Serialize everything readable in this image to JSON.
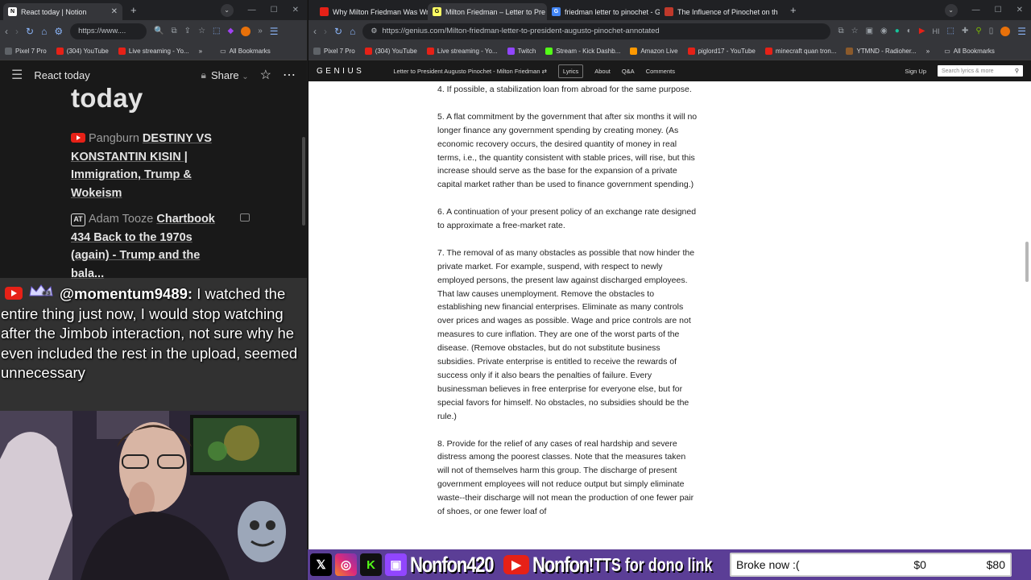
{
  "left_browser": {
    "tabs": [
      {
        "title": "React today | Notion",
        "active": true
      }
    ],
    "url": "https://www....",
    "bookmarks": [
      {
        "label": "Pixel 7 Pro",
        "color": "#5f6368"
      },
      {
        "label": "(304) YouTube",
        "color": "#e62117"
      },
      {
        "label": "Live streaming - Yo...",
        "color": "#e62117"
      }
    ],
    "bookmarks_more": "All Bookmarks"
  },
  "notion": {
    "page_header": "React today",
    "share_label": "Share",
    "title": "today",
    "items": [
      {
        "source": "Pangburn",
        "title": "DESTINY VS KONSTANTIN KISIN | Immigration, Trump & Wokeism",
        "badge": "youtube"
      },
      {
        "source": "Adam Tooze",
        "title": "Chartbook 434 Back to the 1970s (again) - Trump and the bala...",
        "badge": "AT"
      }
    ]
  },
  "chat": {
    "username": "@momentum9489:",
    "badge_text": "#3",
    "message": "I watched the entire thing just now, I would stop watching after the Jimbob interaction, not sure why he even included the rest in the upload, seemed unnecessary"
  },
  "right_browser": {
    "tabs": [
      {
        "title": "Why Milton Friedman Was Wro",
        "fav_color": "#e62117",
        "active": false
      },
      {
        "title": "Milton Friedman – Letter to Pre",
        "fav_color": "#ffff64",
        "active": true
      },
      {
        "title": "friedman letter to pinochet - G",
        "fav_color": "#4285f4",
        "active": false
      },
      {
        "title": "The Influence of Pinochet on th",
        "fav_color": "#c0392b",
        "active": false
      }
    ],
    "url": "https://genius.com/Milton-friedman-letter-to-president-augusto-pinochet-annotated",
    "bookmarks": [
      {
        "label": "Pixel 7 Pro",
        "color": "#5f6368"
      },
      {
        "label": "(304) YouTube",
        "color": "#e62117"
      },
      {
        "label": "Live streaming - Yo...",
        "color": "#e62117"
      },
      {
        "label": "Twitch",
        "color": "#9146ff"
      },
      {
        "label": "Stream - Kick Dashb...",
        "color": "#53fc18"
      },
      {
        "label": "Amazon Live",
        "color": "#ff9900"
      },
      {
        "label": "piglord17 - YouTube",
        "color": "#e62117"
      },
      {
        "label": "minecraft quan tron...",
        "color": "#e62117"
      },
      {
        "label": "YTMND - Radioher...",
        "color": "#8b5a2b"
      }
    ],
    "bookmarks_more": "All Bookmarks"
  },
  "genius": {
    "logo": "GENIUS",
    "song_title": "Letter to President Augusto Pinochet - Milton Friedman",
    "nav": [
      "Lyrics",
      "About",
      "Q&A",
      "Comments"
    ],
    "active_nav": "Lyrics",
    "signup": "Sign Up",
    "search_placeholder": "Search lyrics & more",
    "paragraphs": [
      "4. If possible, a stabilization loan from abroad for the same purpose.",
      "5. A flat commitment by the government that after six months it will no longer finance any government spending by creating money. (As economic recovery occurs, the desired quantity of money in real terms, i.e., the quantity consistent with stable prices, will rise, but this increase should serve as the base for the expansion of a private capital market rather than be used to finance government spending.)",
      "6. A continuation of your present policy of an exchange rate designed to approximate a free-market rate.",
      "7. The removal of as many obstacles as possible that now hinder the private market. For example, suspend, with respect to newly employed persons, the present law against discharged employees. That law causes unemployment. Remove the obstacles to establishing new financial enterprises. Eliminate as many controls over prices and wages as possible. Wage and price controls are not measures to cure inflation. They are one of the worst parts of the disease. (Remove obstacles, but do not substitute business subsidies. Private enterprise is entitled to receive the rewards of success only if it also bears the penalties of failure. Every businessman believes in free enterprise for everyone else, but for special favors for himself. No obstacles, no subsidies should be the rule.)",
      "8. Provide for the relief of any cases of real hardship and severe distress among the poorest classes. Note that the measures taken will not of themselves harm this group. The discharge of present government employees will not reduce output but simply eliminate waste--their discharge will not mean the production of one fewer pair of shoes, or one fewer loaf of"
    ]
  },
  "stream_bar": {
    "handle_twitch": "Nonfon420",
    "handle_youtube": "Nonfon",
    "tts_text": "!TTS for dono link",
    "goal_title": "Broke now :(",
    "goal_current": "$0",
    "goal_target": "$80"
  }
}
